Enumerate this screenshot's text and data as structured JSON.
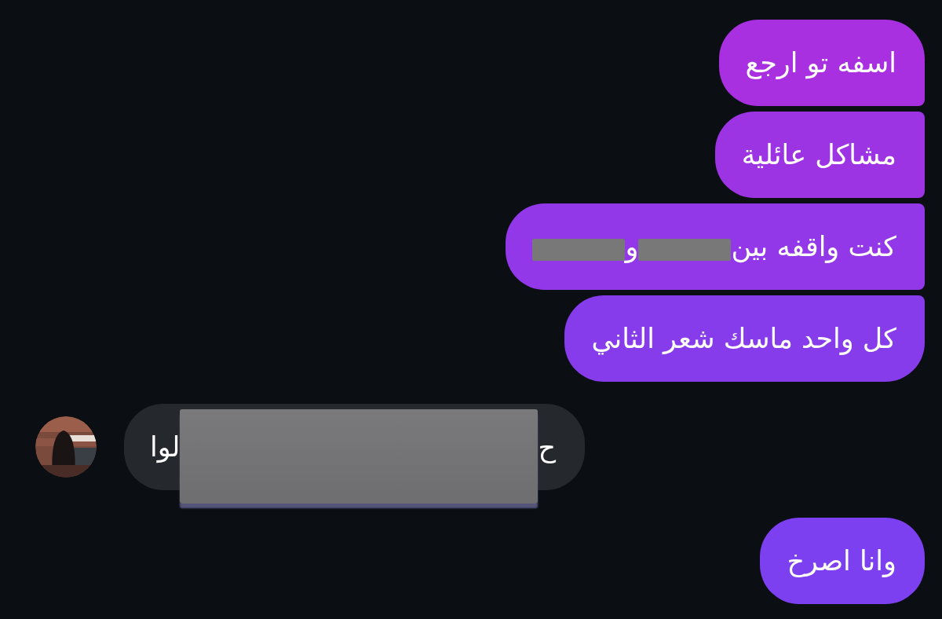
{
  "messages": [
    {
      "kind": "sent",
      "segments": [
        {
          "kind": "text",
          "text": "اسفه تو ارجع"
        }
      ]
    },
    {
      "kind": "sent",
      "segments": [
        {
          "kind": "text",
          "text": "مشاكل عائلية"
        }
      ]
    },
    {
      "kind": "sent",
      "segments": [
        {
          "kind": "text",
          "text": "كنت واقفه بين"
        },
        {
          "kind": "redacted"
        },
        {
          "kind": "text",
          "text": "و"
        },
        {
          "kind": "redacted"
        }
      ]
    },
    {
      "kind": "sent",
      "segments": [
        {
          "kind": "text",
          "text": "كل واحد ماسك شعر الثاني"
        }
      ]
    },
    {
      "kind": "received",
      "segments": [
        {
          "kind": "text",
          "text": "ح"
        },
        {
          "kind": "redacted"
        },
        {
          "kind": "text",
          "text": "لوا"
        }
      ]
    },
    {
      "kind": "sent",
      "segments": [
        {
          "kind": "text",
          "text": "وانا اصرخ"
        }
      ]
    }
  ]
}
